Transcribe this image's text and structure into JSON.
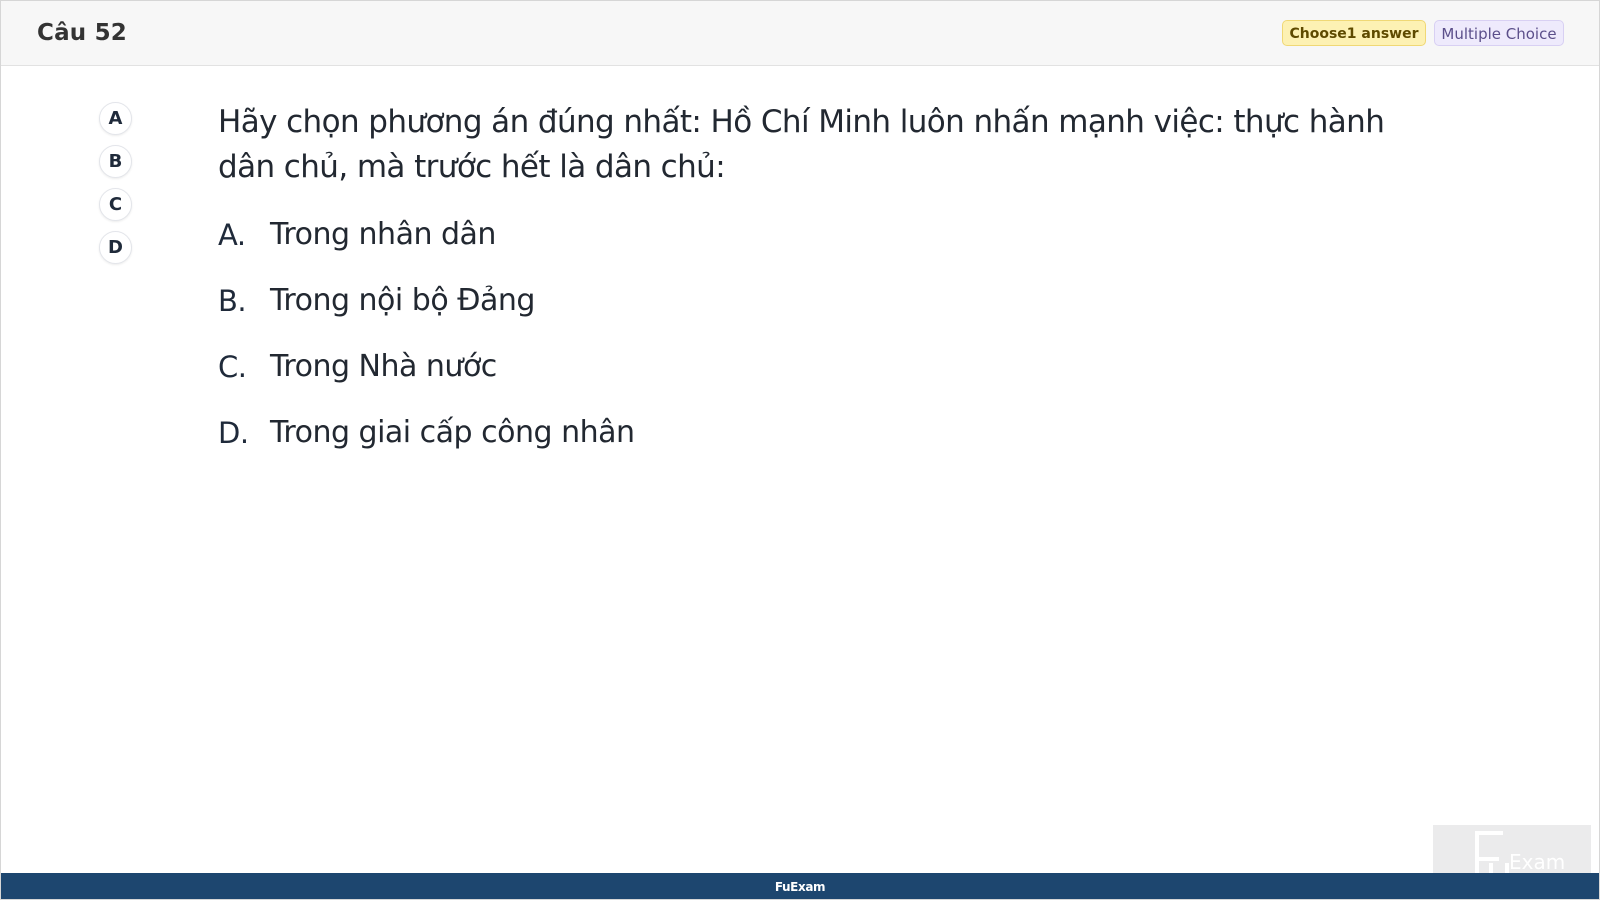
{
  "header": {
    "question_number": "Câu 52",
    "badge_choose": "Choose1 answer",
    "badge_type": "Multiple Choice"
  },
  "navigator": {
    "items": [
      "A",
      "B",
      "C",
      "D"
    ]
  },
  "question": {
    "text": "Hãy chọn phương án đúng nhất: Hồ Chí Minh luôn nhấn mạnh việc: thực hành dân chủ, mà trước hết là dân chủ:"
  },
  "answers": [
    {
      "letter": "A.",
      "text": "Trong nhân dân"
    },
    {
      "letter": "B.",
      "text": "Trong nội bộ Đảng"
    },
    {
      "letter": "C.",
      "text": "Trong Nhà nước"
    },
    {
      "letter": "D.",
      "text": "Trong giai cấp công nhân"
    }
  ],
  "footer": {
    "text": "FuExam"
  },
  "watermark": {
    "text": "FUExam"
  },
  "colors": {
    "footer_bg": "#1d466f",
    "badge_choose_bg": "#fdf1b3",
    "badge_type_bg": "#eeeafc"
  }
}
